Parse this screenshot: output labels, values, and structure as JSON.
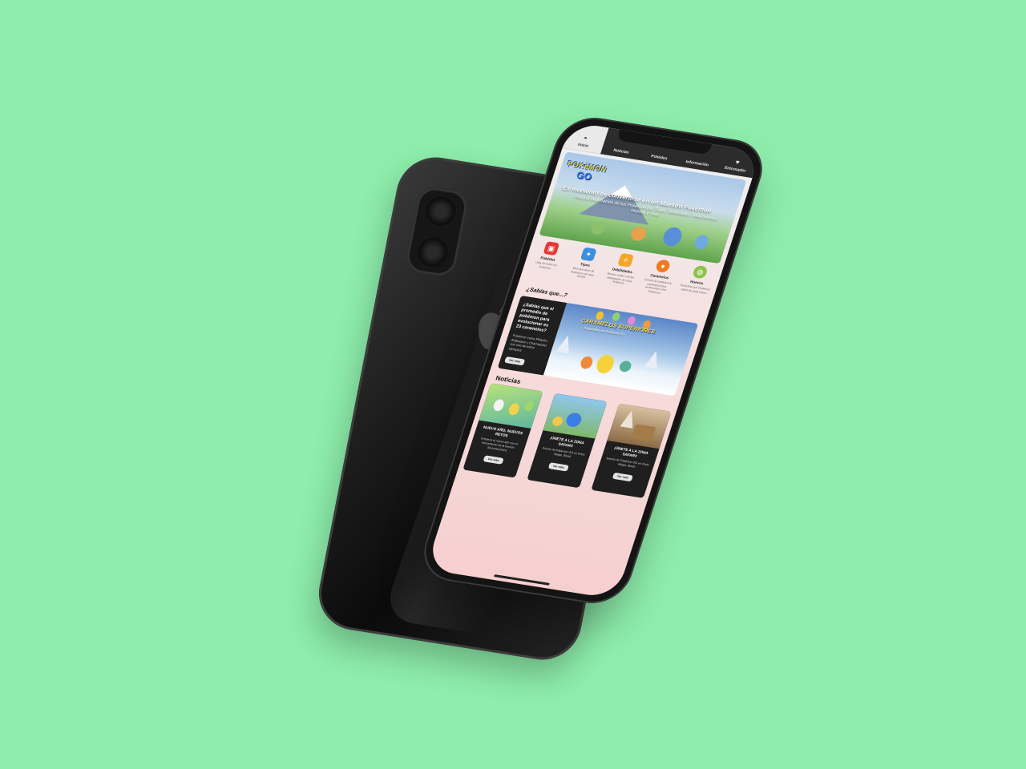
{
  "tabs": [
    {
      "label": "Inicio",
      "icon": "pokeball-icon"
    },
    {
      "label": "Noticias",
      "icon": ""
    },
    {
      "label": "Pokédex",
      "icon": ""
    },
    {
      "label": "Información",
      "icon": ""
    },
    {
      "label": "Entrenador",
      "icon": "heart-icon"
    }
  ],
  "hero": {
    "logo_top": "POKéMON",
    "logo_bottom": "GO",
    "headline": "Es momento de convertirse en un Maestro Pokémon",
    "subline": "Filtra la información de tus Pokémon por Tipos, Debilidades, Movimientos, Huevos y más."
  },
  "features": [
    {
      "name": "Pokédex",
      "desc": "Lista de todos los Pokémon",
      "icon": "pokedex-icon",
      "color": "#e53935"
    },
    {
      "name": "Tipos",
      "desc": "Mira qué tipos de Pokémon son más fuertes",
      "icon": "type-icon",
      "color": "#3b8fe0"
    },
    {
      "name": "Debilidades",
      "desc": "Revisa cuáles son las debilidades de cada Pokémon",
      "icon": "weakness-icon",
      "color": "#f2a72b"
    },
    {
      "name": "Caramelos",
      "desc": "Conoce la cantidad de caramelos para evolucionar a tus Pokémon",
      "icon": "candy-icon",
      "color": "#f07a22"
    },
    {
      "name": "Huevos",
      "desc": "Descubre qué Pokémon salen de cada huevo",
      "icon": "egg-icon",
      "color": "#8bc34a"
    }
  ],
  "did_you_know": {
    "section_title": "¿Sabías que...?",
    "question": "¿Sabías que el promedio de pokémon para evolucionar es 23 caramelos?",
    "detail": "Pokémon como Pikachu, Bulbasaur y Charmander son uno de estos ejemplos",
    "button": "Ver más",
    "banner_title": "CARAMELOS SUPERIORES",
    "banner_sub": "Disponibles en Pokémon GO"
  },
  "news": {
    "section_title": "Noticias",
    "items": [
      {
        "title": "NUEVO AÑO, NUEVOS RETOS",
        "desc": "Empieza el nuevo año con el lanzamiento de la función Sincroaventura",
        "button": "Ver más"
      },
      {
        "title": "¡ÚNETE A LA ZONA SAFARI!",
        "desc": "Evento de Pokémon GO en Porto Alegre, Brasil",
        "button": "Ver más"
      },
      {
        "title": "¡ÚNETE A LA ZONA SAFARI!",
        "desc": "Evento de Pokémon GO en Porto Alegre, Brasil",
        "button": "Ver más"
      }
    ]
  },
  "colors": {
    "background": "#8eeeac",
    "tabbar": "#2c2c2c",
    "card_dark": "#1f1f1f"
  }
}
